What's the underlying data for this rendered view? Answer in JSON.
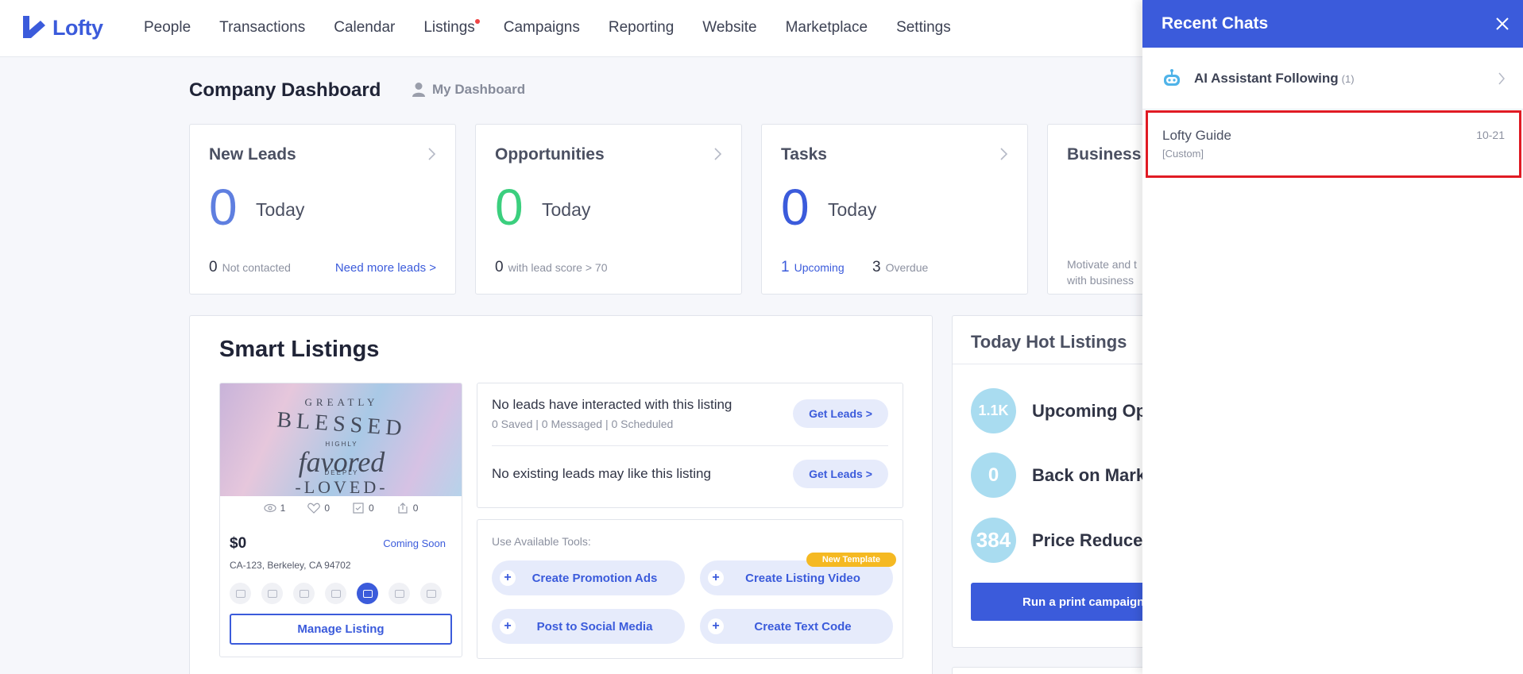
{
  "brand": {
    "name": "Lofty",
    "accent": "#3b5bdb"
  },
  "nav": {
    "items": [
      {
        "label": "People"
      },
      {
        "label": "Transactions"
      },
      {
        "label": "Calendar"
      },
      {
        "label": "Listings",
        "badge_dot": true
      },
      {
        "label": "Campaigns"
      },
      {
        "label": "Reporting"
      },
      {
        "label": "Website"
      },
      {
        "label": "Marketplace"
      },
      {
        "label": "Settings"
      }
    ]
  },
  "dashboard": {
    "title": "Company Dashboard",
    "switch_label": "My Dashboard"
  },
  "cards": {
    "new_leads": {
      "title": "New Leads",
      "value": "0",
      "period": "Today",
      "foot_num": "0",
      "foot_text": "Not contacted",
      "link": "Need more leads >",
      "color": "#5f7fe0"
    },
    "opportunities": {
      "title": "Opportunities",
      "value": "0",
      "period": "Today",
      "foot_num": "0",
      "foot_text": "with lead score > 70",
      "color": "#3bcf7e"
    },
    "tasks": {
      "title": "Tasks",
      "value": "0",
      "period": "Today",
      "upcoming_num": "1",
      "upcoming_label": "Upcoming",
      "overdue_num": "3",
      "overdue_label": "Overdue",
      "color": "#3b5bdb"
    },
    "business": {
      "title": "Business",
      "desc_line1": "Motivate and t",
      "desc_line2": "with business"
    }
  },
  "smart_listings": {
    "title": "Smart Listings",
    "listing": {
      "image_text": {
        "l1": "GREATLY",
        "l2": "BLESSED",
        "l3": "HIGHLY",
        "l4": "favored",
        "l5": "DEEPLY",
        "l6": "-LOVED-"
      },
      "views": "1",
      "likes": "0",
      "saves": "0",
      "shares": "0",
      "price": "$0",
      "status": "Coming Soon",
      "address": "CA-123, Berkeley, CA 94702",
      "manage_label": "Manage Listing"
    },
    "leads": {
      "row1_main": "No leads have interacted with this listing",
      "row1_sub": "0 Saved | 0 Messaged | 0 Scheduled",
      "row1_btn": "Get Leads >",
      "row2_main": "No existing leads may like this listing",
      "row2_btn": "Get Leads >"
    },
    "tools": {
      "label": "Use Available Tools:",
      "promo": "Create Promotion Ads",
      "video": "Create Listing Video",
      "video_badge": "New Template",
      "social": "Post to Social Media",
      "textcode": "Create Text Code",
      "plus": "+"
    }
  },
  "hot_listings": {
    "title": "Today Hot Listings",
    "rows": [
      {
        "count": "1.1K",
        "label": "Upcoming Op"
      },
      {
        "count": "0",
        "label": "Back on Mark"
      },
      {
        "count": "384",
        "label": "Price Reduce"
      }
    ],
    "print_btn": "Run a print campaign"
  },
  "drawer": {
    "title": "Recent Chats",
    "ai_label": "AI Assistant Following",
    "ai_count": "(1)",
    "chat": {
      "name": "Lofty Guide",
      "tag": "[Custom]",
      "date": "10-21"
    }
  }
}
